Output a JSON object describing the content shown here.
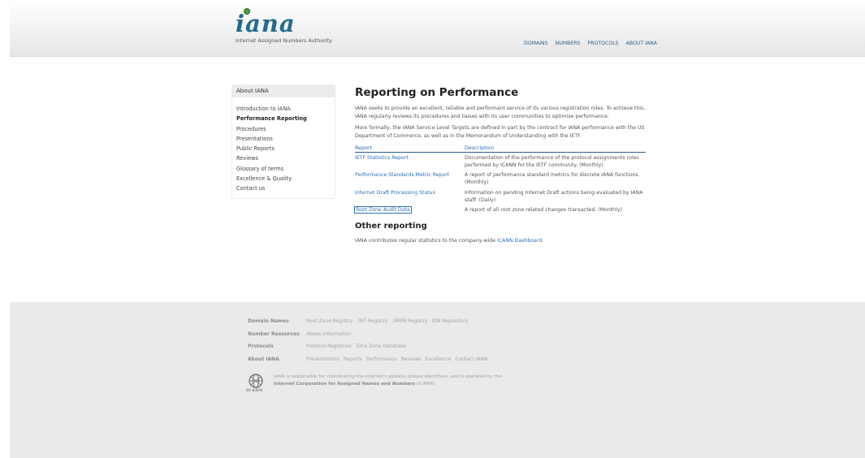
{
  "header": {
    "logo_word": "iana",
    "logo_sub": "Internet Assigned Numbers Authority",
    "nav": [
      "DOMAINS",
      "NUMBERS",
      "PROTOCOLS",
      "ABOUT IANA"
    ]
  },
  "sidebar": {
    "title": "About IANA",
    "items": [
      "Introduction to IANA",
      "Performance Reporting",
      "Procedures",
      "Presentations",
      "Public Reports",
      "Reviews",
      "Glossary of terms",
      "Excellence & Quality",
      "Contact us"
    ],
    "active_index": 1
  },
  "main": {
    "title": "Reporting on Performance",
    "para1": "IANA seeks to provide an excellent, reliable and performant service of its various registration roles. To achieve this, IANA regularly reviews its procedures and liaises with its user communities to optimise performance.",
    "para2": "More formally, the IANA Service Level Targets are defined in part by the contract for IANA performance with the US Department of Commerce, as well as in the Memorandum of Understanding with the IETF.",
    "table": {
      "headers": [
        "Report",
        "Description"
      ],
      "rows": [
        {
          "report": "IETF Statistics Report",
          "description": "Documentation of the performance of the protocol assignments roles performed by ICANN for the IETF community. (Monthly)"
        },
        {
          "report": "Performance Standards Metric Report",
          "description": "A report of performance standard metrics for discrete IANA functions. (Monthly)"
        },
        {
          "report": "Internet Draft Processing Status",
          "description": "Information on pending Internet Draft actions being evaluated by IANA staff. (Daily)"
        },
        {
          "report": "Root Zone Audit Data",
          "description": "A report of all root zone related changes transacted. (Monthly)"
        }
      ]
    },
    "other_title": "Other reporting",
    "other_text": "IANA contributes regular statistics to the company-wide ",
    "other_link": "ICANN Dashboard",
    "other_end": "."
  },
  "footer": {
    "rows": [
      {
        "label": "Domain Names",
        "links": [
          "Root Zone Registry",
          ".INT Registry",
          ".ARPA Registry",
          "IDN Repository"
        ]
      },
      {
        "label": "Number Resources",
        "links": [
          "Abuse Information"
        ]
      },
      {
        "label": "Protocols",
        "links": [
          "Protocol Registries",
          "Time Zone Database"
        ]
      },
      {
        "label": "About IANA",
        "links": [
          "Presentations",
          "Reports",
          "Performance",
          "Reviews",
          "Excellence",
          "Contact IANA"
        ]
      }
    ],
    "icann_word": "ICANN",
    "icann_line1": "IANA is responsible for coordinating the Internet's globally unique identifiers, and is operated by the",
    "icann_bold": "Internet Corporation for Assigned Names and Numbers",
    "icann_end": " (ICANN)."
  },
  "colors": {
    "link": "#2d6fb5",
    "logo": "#226b8a",
    "footer_bg": "#e9eaeb"
  }
}
